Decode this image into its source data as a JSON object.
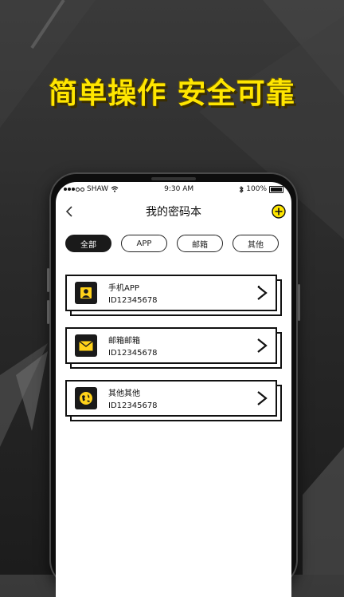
{
  "headline": "简单操作 安全可靠",
  "statusbar": {
    "carrier": "SHAW",
    "time": "9:30 AM",
    "battery": "100%"
  },
  "nav": {
    "title": "我的密码本",
    "back_icon": "chevron-left-icon",
    "add_icon": "plus-circle-icon"
  },
  "filters": [
    {
      "label": "全部",
      "active": true
    },
    {
      "label": "APP",
      "active": false
    },
    {
      "label": "邮箱",
      "active": false
    },
    {
      "label": "其他",
      "active": false
    }
  ],
  "entries": [
    {
      "name": "手机APP",
      "id": "ID12345678",
      "icon": "user-icon"
    },
    {
      "name": "邮箱邮箱",
      "id": "ID12345678",
      "icon": "mail-icon"
    },
    {
      "name": "其他其他",
      "id": "ID12345678",
      "icon": "globe-icon"
    }
  ],
  "colors": {
    "accent": "#ffe600",
    "dark": "#1a1a1a",
    "background": "#2a2a2a"
  }
}
